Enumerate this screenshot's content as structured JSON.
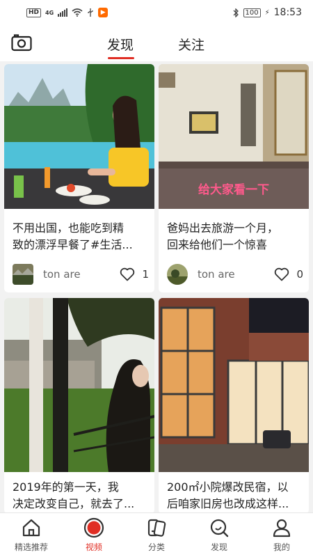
{
  "status_bar": {
    "hd": "HD",
    "network": "4G",
    "battery": "100",
    "time": "18:53"
  },
  "header": {
    "tabs": [
      {
        "label": "发现",
        "active": true
      },
      {
        "label": "关注",
        "active": false
      }
    ],
    "accent_color": "#e02e24"
  },
  "feed": [
    {
      "title_lines": [
        "不用出国，也能吃到精",
        "致的漂浮早餐了#生活..."
      ],
      "author": "ton are",
      "likes": "1",
      "image": "infinity-pool-breakfast-photo"
    },
    {
      "title_lines": [
        "爸妈出去旅游一个月，",
        "回来给他们一个惊喜"
      ],
      "author": "ton are",
      "likes": "0",
      "image": "old-room-renovation-photo",
      "overlay_caption": "给大家看一下"
    },
    {
      "title_lines": [
        "2019年的第一天，我",
        "决定改变自己，就去了..."
      ],
      "image": "woman-on-balcony-photo"
    },
    {
      "title_lines": [
        "200㎡小院爆改民宿，以",
        "后咱家旧房也改成这样..."
      ],
      "image": "brick-house-night-photo"
    }
  ],
  "bottom_nav": [
    {
      "label": "精选推荐",
      "icon": "home-icon",
      "active": false
    },
    {
      "label": "视频",
      "icon": "record-icon",
      "active": true
    },
    {
      "label": "分类",
      "icon": "category-icon",
      "active": false
    },
    {
      "label": "发现",
      "icon": "discover-icon",
      "active": false
    },
    {
      "label": "我的",
      "icon": "profile-icon",
      "active": false
    }
  ]
}
